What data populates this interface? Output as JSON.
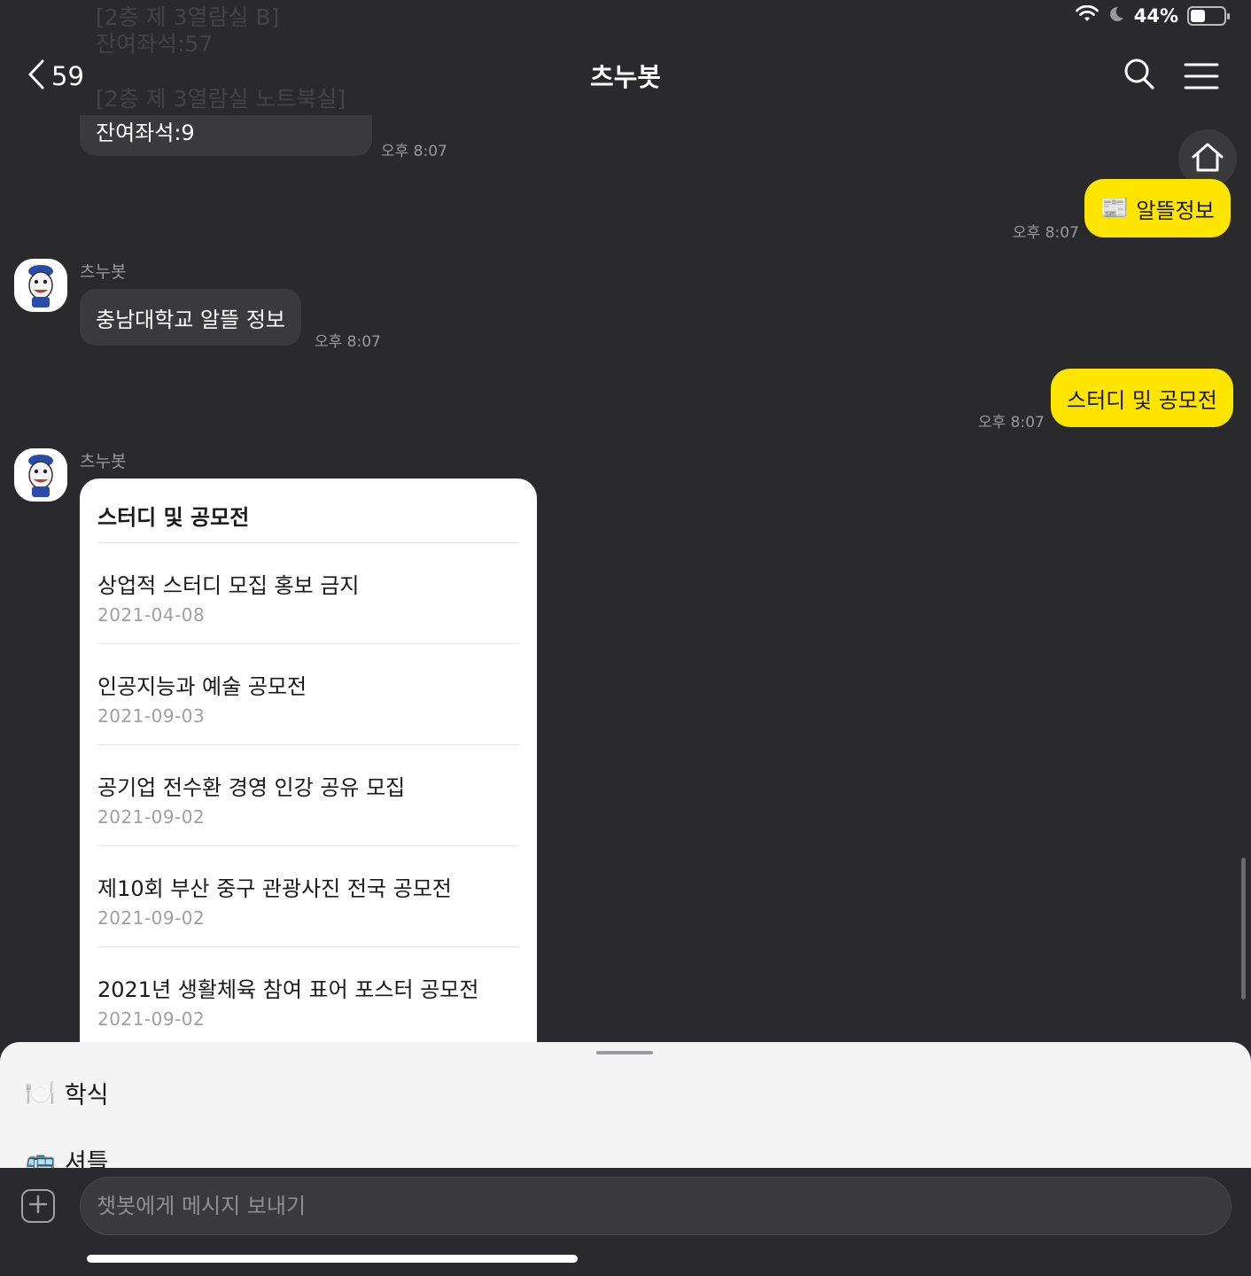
{
  "status_bar": {
    "battery_percent": "44%",
    "battery_level": 0.44
  },
  "previous_message": {
    "faded_lines": [
      "[2층 제 3열람실 B]",
      "잔여좌석:57",
      "[2층 제 3열람실 노트북실]"
    ],
    "last_line": "잔여좌석:9",
    "time": "오후 8:07"
  },
  "header": {
    "back_count": "59",
    "title": "츠누봇"
  },
  "messages": {
    "user1": {
      "emoji": "📰",
      "text": "알뜰정보",
      "time": "오후 8:07"
    },
    "bot1": {
      "sender": "츠누봇",
      "text": "충남대학교 알뜰 정보",
      "time": "오후 8:07"
    },
    "user2": {
      "text": "스터디 및 공모전",
      "time": "오후 8:07"
    },
    "bot2": {
      "sender": "츠누봇"
    }
  },
  "card": {
    "title": "스터디 및 공모전",
    "items": [
      {
        "title": "상업적 스터디 모집 홍보 금지",
        "date": "2021-04-08"
      },
      {
        "title": "인공지능과 예술 공모전",
        "date": "2021-09-03"
      },
      {
        "title": "공기업 전수환 경영 인강 공유 모집",
        "date": "2021-09-02"
      },
      {
        "title": "제10회 부산 중구 관광사진 전국 공모전",
        "date": "2021-09-02"
      },
      {
        "title": "2021년 생활체육 참여 표어 포스터 공모전",
        "date": "2021-09-02"
      }
    ]
  },
  "quick_menu": {
    "items": [
      {
        "emoji": "🍽️",
        "label": "학식"
      },
      {
        "emoji": "🚌",
        "label": "셔틀"
      }
    ]
  },
  "input": {
    "placeholder": "챗봇에게 메시지 보내기"
  },
  "colors": {
    "background": "#2a2a2c",
    "bubble_grey": "#3a3a3c",
    "bubble_yellow": "#fee500",
    "sheet": "#f4f4f5"
  },
  "icons": [
    "wifi-icon",
    "moon-icon",
    "battery-icon",
    "back-chevron-icon",
    "search-icon",
    "menu-icon",
    "home-icon",
    "plus-icon",
    "avatar-icon"
  ]
}
